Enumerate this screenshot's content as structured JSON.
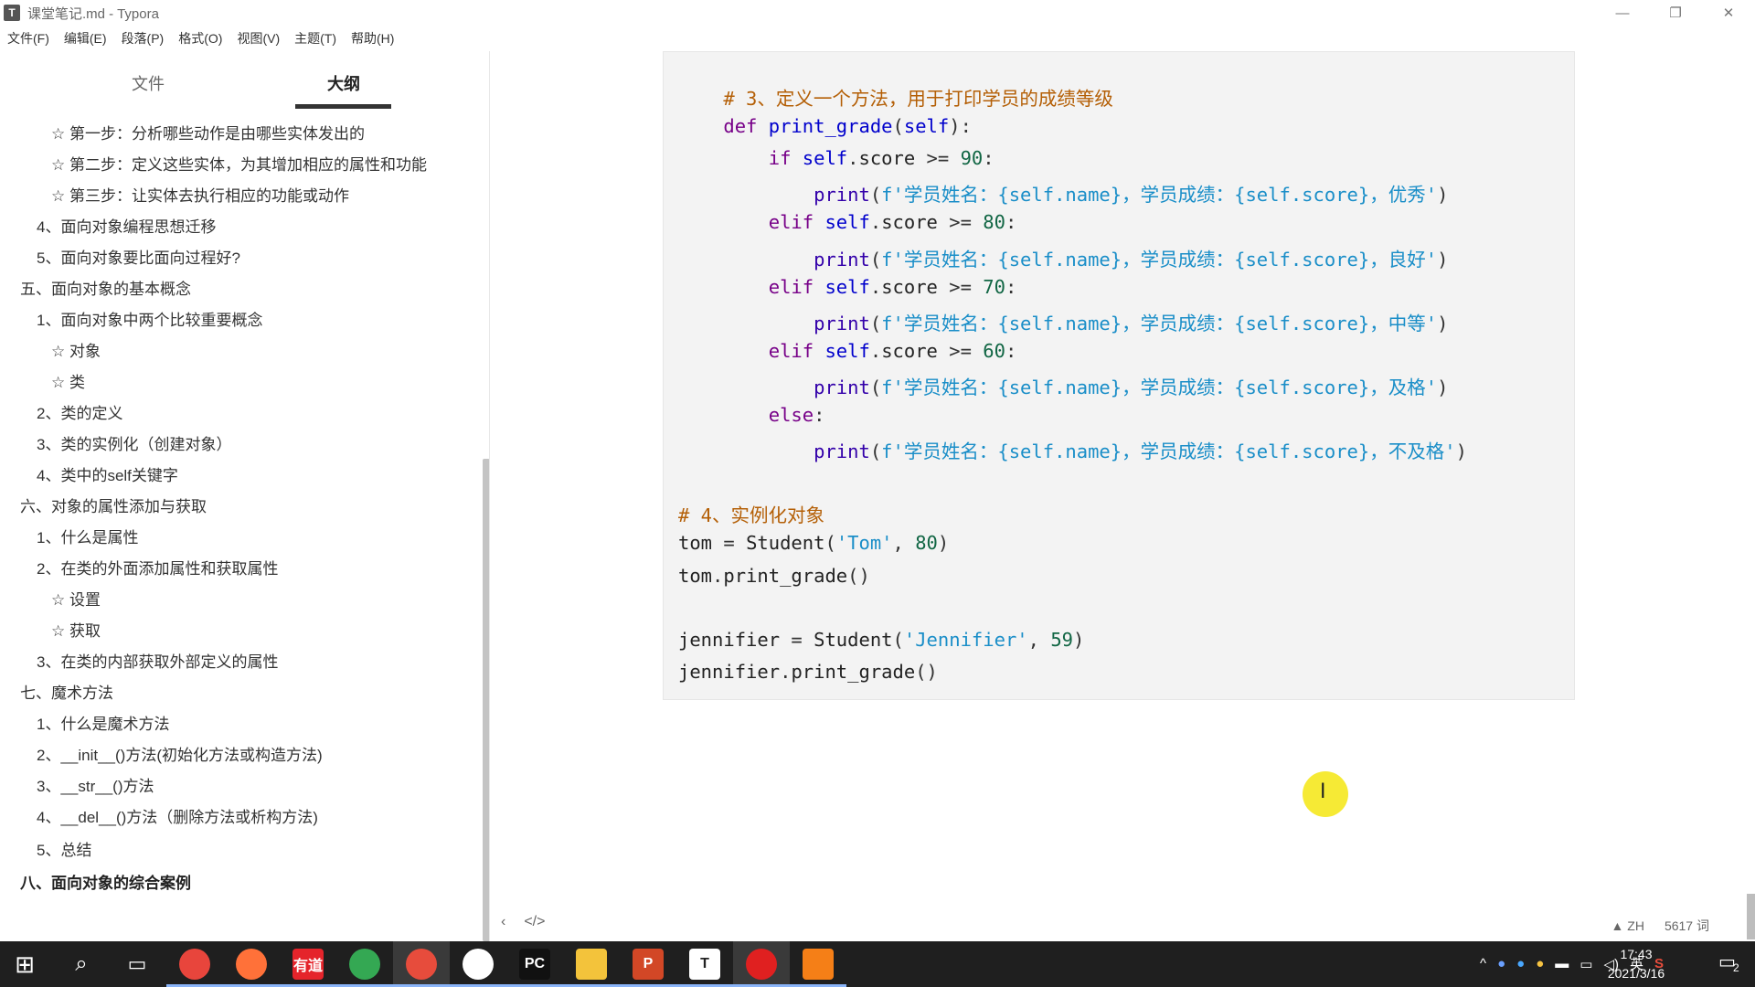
{
  "window": {
    "title": "课堂笔记.md - Typora",
    "app_icon": "T",
    "minimize": "—",
    "restore": "❐",
    "close": "✕"
  },
  "menu": [
    "文件(F)",
    "编辑(E)",
    "段落(P)",
    "格式(O)",
    "视图(V)",
    "主题(T)",
    "帮助(H)"
  ],
  "sidebar": {
    "tab_files": "文件",
    "tab_outline": "大纲",
    "outline": [
      {
        "text": "☆ 第一步：分析哪些动作是由哪些实体发出的",
        "bold": false
      },
      {
        "text": "☆ 第二步：定义这些实体，为其增加相应的属性和功能",
        "bold": false
      },
      {
        "text": "☆ 第三步：让实体去执行相应的功能或动作",
        "bold": false
      },
      {
        "text": "4、面向对象编程思想迁移",
        "bold": false
      },
      {
        "text": "5、面向对象要比面向过程好?",
        "bold": false
      },
      {
        "text": "五、面向对象的基本概念",
        "bold": false
      },
      {
        "text": "1、面向对象中两个比较重要概念",
        "bold": false
      },
      {
        "text": "☆ 对象",
        "bold": false
      },
      {
        "text": "☆ 类",
        "bold": false
      },
      {
        "text": "2、类的定义",
        "bold": false
      },
      {
        "text": "3、类的实例化（创建对象）",
        "bold": false
      },
      {
        "text": "4、类中的self关键字",
        "bold": false
      },
      {
        "text": "六、对象的属性添加与获取",
        "bold": false
      },
      {
        "text": "1、什么是属性",
        "bold": false
      },
      {
        "text": "2、在类的外面添加属性和获取属性",
        "bold": false
      },
      {
        "text": "☆ 设置",
        "bold": false
      },
      {
        "text": "☆ 获取",
        "bold": false
      },
      {
        "text": "3、在类的内部获取外部定义的属性",
        "bold": false
      },
      {
        "text": "七、魔术方法",
        "bold": false
      },
      {
        "text": "1、什么是魔术方法",
        "bold": false
      },
      {
        "text": "2、__init__()方法(初始化方法或构造方法)",
        "bold": false
      },
      {
        "text": "3、__str__()方法",
        "bold": false
      },
      {
        "text": "4、__del__()方法（删除方法或析构方法)",
        "bold": false
      },
      {
        "text": "5、总结",
        "bold": false
      },
      {
        "text": "八、面向对象的综合案例",
        "bold": true
      }
    ]
  },
  "code": {
    "language": "python",
    "lines": [
      "    # 3、定义一个方法，用于打印学员的成绩等级",
      "    def print_grade(self):",
      "        if self.score >= 90:",
      "            print(f'学员姓名：{self.name}，学员成绩：{self.score}，优秀')",
      "        elif self.score >= 80:",
      "            print(f'学员姓名：{self.name}，学员成绩：{self.score}，良好')",
      "        elif self.score >= 70:",
      "            print(f'学员姓名：{self.name}，学员成绩：{self.score}，中等')",
      "        elif self.score >= 60:",
      "            print(f'学员姓名：{self.name}，学员成绩：{self.score}，及格')",
      "        else:",
      "            print(f'学员姓名：{self.name}，学员成绩：{self.score}，不及格')",
      "",
      "# 4、实例化对象",
      "tom = Student('Tom', 80)",
      "tom.print_grade()",
      "",
      "jennifier = Student('Jennifier', 59)",
      "jennifier.print_grade()"
    ]
  },
  "statusbar": {
    "toggle_sidebar": "‹",
    "source_mode": "</>",
    "lang": "ZH",
    "word_count": "5617 词"
  },
  "taskbar": {
    "start": "⊞",
    "search": "⌕",
    "task_view": "▭",
    "apps": [
      {
        "name": "chrome",
        "label": "",
        "color": "#e8453c"
      },
      {
        "name": "firefox",
        "label": "",
        "color": "#ff7139"
      },
      {
        "name": "youdao",
        "label": "有道",
        "color": "#e5242b"
      },
      {
        "name": "photos",
        "label": "",
        "color": "#34a853"
      },
      {
        "name": "recorder",
        "label": "",
        "color": "#e74c3c"
      },
      {
        "name": "clock",
        "label": "",
        "color": "#ffffff"
      },
      {
        "name": "pycharm",
        "label": "PC",
        "color": "#111111"
      },
      {
        "name": "explorer",
        "label": "",
        "color": "#f3c33b"
      },
      {
        "name": "powerpoint",
        "label": "P",
        "color": "#d24726"
      },
      {
        "name": "typora",
        "label": "T",
        "color": "#ffffff"
      },
      {
        "name": "record",
        "label": "",
        "color": "#e02020"
      },
      {
        "name": "sublime",
        "label": "",
        "color": "#f57f17"
      }
    ],
    "tray_ime": "英",
    "time": "17:43",
    "date": "2021/3/16",
    "notifications": "2"
  }
}
